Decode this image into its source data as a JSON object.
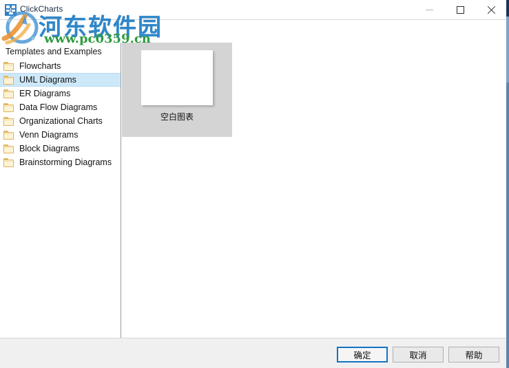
{
  "window": {
    "title": "ClickCharts",
    "app_icon": "clickcharts-app-icon",
    "controls": {
      "minimize": "minimize-icon",
      "maximize": "maximize-icon",
      "close": "close-icon"
    }
  },
  "tree": {
    "root_label": "Templates and Examples",
    "items": [
      {
        "label": "Flowcharts",
        "selected": false
      },
      {
        "label": "UML Diagrams",
        "selected": true
      },
      {
        "label": "ER Diagrams",
        "selected": false
      },
      {
        "label": "Data Flow Diagrams",
        "selected": false
      },
      {
        "label": "Organizational Charts",
        "selected": false
      },
      {
        "label": "Venn Diagrams",
        "selected": false
      },
      {
        "label": "Block Diagrams",
        "selected": false
      },
      {
        "label": "Brainstorming Diagrams",
        "selected": false
      }
    ],
    "scrollbar": {
      "left_arrow": "‹",
      "right_arrow": "›"
    }
  },
  "templates": {
    "tiles": [
      {
        "label": "空白图表",
        "selected": true
      }
    ]
  },
  "footer": {
    "ok_label": "确定",
    "cancel_label": "取消",
    "help_label": "帮助"
  },
  "watermark": {
    "site_name": "河东软件园",
    "url": "www.pc0359.cn"
  },
  "colors": {
    "selection_blue": "#cde8f9",
    "focus_border": "#1173c4",
    "panel_gray": "#d4d4d4",
    "watermark_blue": "#2f86c8",
    "watermark_green": "#2e9b3f"
  }
}
